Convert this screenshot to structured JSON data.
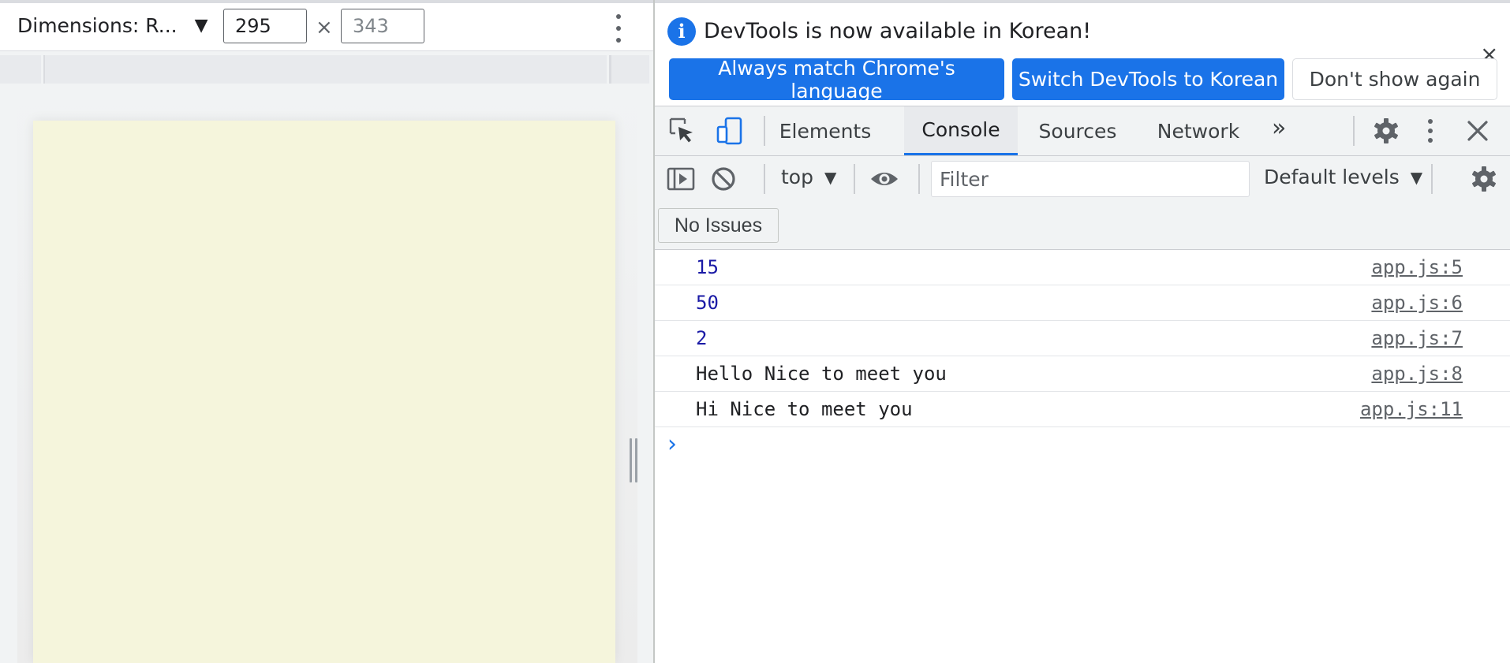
{
  "device_toolbar": {
    "dimensions_label": "Dimensions: R...",
    "width_value": "295",
    "height_placeholder": "343",
    "times": "×"
  },
  "infobar": {
    "message": "DevTools is now available in Korean!",
    "buttons": [
      "Always match Chrome's language",
      "Switch DevTools to Korean",
      "Don't show again"
    ],
    "close": "×"
  },
  "tabs": [
    "Elements",
    "Console",
    "Sources",
    "Network"
  ],
  "active_tab": "Console",
  "console_toolbar": {
    "context": "top",
    "filter_placeholder": "Filter",
    "levels": "Default levels"
  },
  "issues": "No Issues",
  "messages": [
    {
      "text": "15",
      "source": "app.js:5"
    },
    {
      "text": "50",
      "source": "app.js:6"
    },
    {
      "text": "2",
      "source": "app.js:7"
    },
    {
      "text": "Hello Nice to meet you",
      "source": "app.js:8"
    },
    {
      "text": "Hi Nice to meet you",
      "source": "app.js:11"
    }
  ],
  "colors": {
    "accent": "#1a73e8",
    "viewport_background": "#f5f5dc",
    "number_output": "#1a1aa6"
  }
}
